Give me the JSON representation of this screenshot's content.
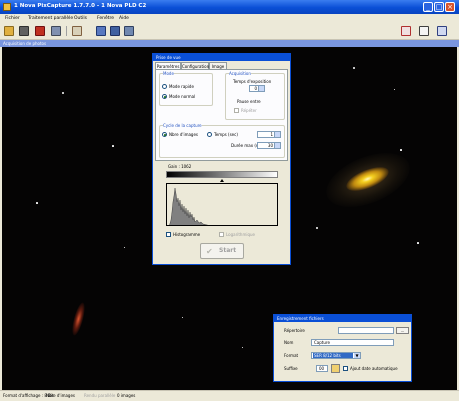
{
  "window": {
    "title": "1 Nova PixCapture 1.7.7.0 - 1 Nova PLD C2",
    "minimize": "_",
    "maximize": "□",
    "close": "×"
  },
  "menu": [
    "Fichier",
    "Traitement parallèle",
    "Outils",
    "Fenêtre",
    "Aide"
  ],
  "toolbar": {
    "buttons": [
      "open-folder-icon",
      "camera-icon",
      "stop-icon",
      "transfer-icon",
      "pointer-icon",
      "sequence-icon",
      "save-icon",
      "monitor-icon",
      "grid-icon",
      "text-tool-icon",
      "help-icon"
    ]
  },
  "subtitle": "Acquisition de photos",
  "capture_panel": {
    "title": "Prise de vue",
    "tabs": [
      "Paramètres",
      "Configuration",
      "Image"
    ],
    "mode_group": "Mode",
    "mode_options": [
      "Mode rapide",
      "Mode normal"
    ],
    "mode_selected": "Mode normal",
    "acq_group": "Acquisition",
    "acq_time_label": "Temps d'exposition",
    "acq_time_value": "0",
    "acq_pause_label": "Pause entre",
    "acq_repeat_label": "Répéter",
    "cycle_group": "Cycle de la capture",
    "cycle_options": [
      "Nbre d'images",
      "Temps (sec)"
    ],
    "cycle_selected": "Nbre d'images",
    "cycle_count_value": "1",
    "cycle_delay_label": "Durée max (sec)",
    "cycle_delay_value": "30",
    "gain_label": "Gain : 1062",
    "histogram_check": "Histogramme",
    "log_check": "Logarithmique",
    "start_button": "Start"
  },
  "save_panel": {
    "title": "Enregistrement fichiers",
    "folder_label": "Répertoire",
    "folder_value": "",
    "browse_label": "...",
    "name_label": "Nom",
    "name_value": "Capture",
    "format_label": "Format",
    "format_value": "SER 8/12 bits",
    "format_options": [
      "SER 8/12 bits"
    ],
    "suffix_label": "Suffixe",
    "suffix_value": "00",
    "auto_check": "Ajout date automatique"
  },
  "status": {
    "left": "Format d'affichage : 8 Bit",
    "mid": "Nbre d'images",
    "right1": "Rendu parallèle",
    "right2": "0 images"
  },
  "colors": {
    "titlebar": "#0a4fd6",
    "panel": "#ece9d8",
    "accent": "#2050c0",
    "galaxy": "#f5d020"
  }
}
